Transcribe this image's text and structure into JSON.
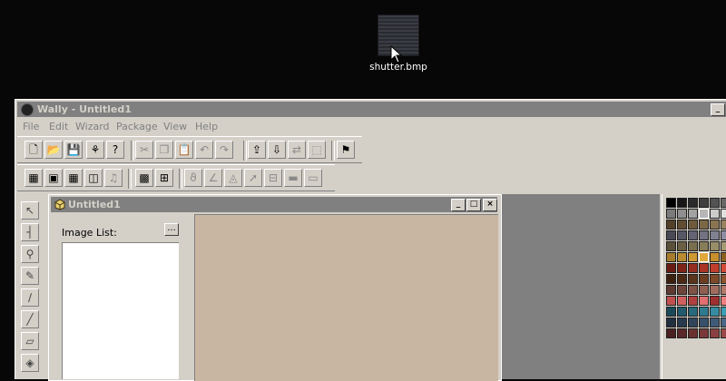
{
  "desktop": {
    "icon_label": "shutter.bmp",
    "icon_name": "bitmap-file-icon"
  },
  "window": {
    "title": "Wally - Untitled1",
    "buttons": [
      "_",
      "□"
    ]
  },
  "menu": [
    "File",
    "Edit",
    "Wizard",
    "Package",
    "View",
    "Help"
  ],
  "toolbar1": [
    {
      "name": "new-icon",
      "glyph": "🗋",
      "disabled": false
    },
    {
      "name": "open-icon",
      "glyph": "📂",
      "disabled": false
    },
    {
      "name": "save-icon",
      "glyph": "💾",
      "disabled": false
    },
    {
      "name": "script-icon",
      "glyph": "⚘",
      "disabled": false
    },
    {
      "name": "help-icon",
      "glyph": "?",
      "disabled": false
    },
    {
      "name": "cut-icon",
      "glyph": "✂",
      "disabled": true
    },
    {
      "name": "copy-icon",
      "glyph": "❐",
      "disabled": true
    },
    {
      "name": "paste-icon",
      "glyph": "📋",
      "disabled": false
    },
    {
      "name": "undo-icon",
      "glyph": "↶",
      "disabled": true
    },
    {
      "name": "redo-icon",
      "glyph": "↷",
      "disabled": true
    },
    {
      "name": "import-icon",
      "glyph": "⇪",
      "disabled": false
    },
    {
      "name": "export-icon",
      "glyph": "⇩",
      "disabled": false
    },
    {
      "name": "convert-icon",
      "glyph": "⇄",
      "disabled": true
    },
    {
      "name": "select-tool-icon",
      "glyph": "⬚",
      "disabled": true
    },
    {
      "name": "package-icon",
      "glyph": "⚑",
      "disabled": false
    }
  ],
  "toolbar2": [
    {
      "name": "palette-view-icon",
      "glyph": "▦",
      "disabled": false
    },
    {
      "name": "image-view-icon",
      "glyph": "▣",
      "disabled": false
    },
    {
      "name": "grid-view-icon",
      "glyph": "▦",
      "disabled": false
    },
    {
      "name": "tile-view-icon",
      "glyph": "◫",
      "disabled": false
    },
    {
      "name": "sound-icon",
      "glyph": "♫",
      "disabled": true
    },
    {
      "name": "pixel-grid-icon",
      "glyph": "▩",
      "disabled": false
    },
    {
      "name": "tile-grid-icon",
      "glyph": "⊞",
      "disabled": false
    },
    {
      "name": "swirl-icon",
      "glyph": "ϑ",
      "disabled": true
    },
    {
      "name": "line-icon",
      "glyph": "∠",
      "disabled": true
    },
    {
      "name": "shape-icon",
      "glyph": "◬",
      "disabled": true
    },
    {
      "name": "arrow-icon",
      "glyph": "➚",
      "disabled": true
    },
    {
      "name": "align-icon",
      "glyph": "⊟",
      "disabled": true
    },
    {
      "name": "layer-icon",
      "glyph": "▬",
      "disabled": true
    },
    {
      "name": "layer2-icon",
      "glyph": "▭",
      "disabled": true
    }
  ],
  "left_tools": [
    {
      "name": "pointer-tool-icon",
      "glyph": "↖"
    },
    {
      "name": "ruler-tool-icon",
      "glyph": "┤"
    },
    {
      "name": "dropper-tool-icon",
      "glyph": "⚲"
    },
    {
      "name": "pencil-tool-icon",
      "glyph": "✎"
    },
    {
      "name": "brush-tool-icon",
      "glyph": "∕"
    },
    {
      "name": "airbrush-tool-icon",
      "glyph": "╱"
    },
    {
      "name": "eraser-tool-icon",
      "glyph": "▱"
    },
    {
      "name": "fill-tool-icon",
      "glyph": "◈"
    }
  ],
  "document": {
    "title": "Untitled1",
    "image_list_label": "Image List:",
    "image_list_button": "...",
    "canvas_color": "#c8b6a2",
    "buttons": [
      "_",
      "□",
      "×"
    ]
  },
  "palette": {
    "colors": [
      "#000000",
      "#171717",
      "#2b2b2b",
      "#3f3f3f",
      "#535353",
      "#676767",
      "#7b7b7b",
      "#8f8f8f",
      "#a3a3a3",
      "#b7b7b7",
      "#cbcbcb",
      "#e0e0e0",
      "#524028",
      "#614d31",
      "#6f5a3b",
      "#7c6747",
      "#8a7553",
      "#98835f",
      "#4a4a56",
      "#575765",
      "#646474",
      "#727283",
      "#808093",
      "#8e8ea3",
      "#5b5138",
      "#6a5f43",
      "#796e4e",
      "#887d5a",
      "#978d67",
      "#a69c74",
      "#a67c2c",
      "#b98a30",
      "#cd9935",
      "#e0a93b",
      "#c8902d",
      "#8a6020",
      "#6a1c14",
      "#7e2419",
      "#942c1f",
      "#a93425",
      "#bf3d2c",
      "#d24a38",
      "#3c2010",
      "#4b2a16",
      "#5b341c",
      "#6b3e22",
      "#7c4929",
      "#8d5430",
      "#5e3a32",
      "#6e463c",
      "#7f5347",
      "#905f52",
      "#a16c5e",
      "#b2796a",
      "#c05050",
      "#d06060",
      "#b04040",
      "#e07070",
      "#a03030",
      "#f08080",
      "#1a4a5a",
      "#205a6c",
      "#276a7e",
      "#2e7b90",
      "#358ca2",
      "#3c9db4",
      "#203040",
      "#283a4e",
      "#30455c",
      "#38506a",
      "#405b78",
      "#486686",
      "#4a2020",
      "#5a2828",
      "#6a3030",
      "#7a3838",
      "#8a4040",
      "#9a4848"
    ],
    "selected_index": 9,
    "selected2_index": 33
  }
}
